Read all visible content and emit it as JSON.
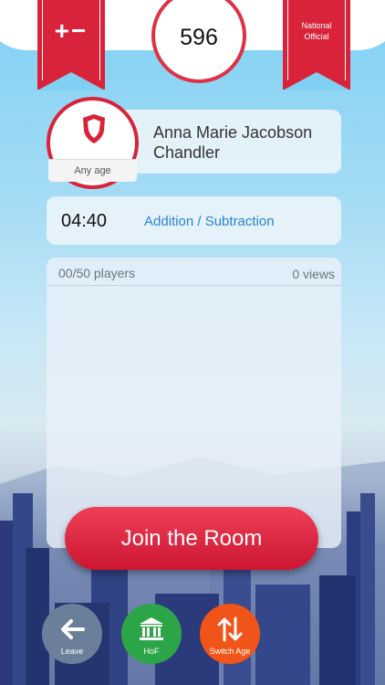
{
  "header": {
    "left_ribbon_label": "+−",
    "score": "596",
    "right_ribbon_label_1": "National",
    "right_ribbon_label_2": "Official"
  },
  "player": {
    "name": "Anna Marie Jacobson Chandler",
    "age_label": "Any age"
  },
  "game": {
    "timer": "04:40",
    "mode": "Addition / Subtraction"
  },
  "room": {
    "players": "00/50 players",
    "views": "0 views",
    "join_label": "Join the Room"
  },
  "bottom_buttons": {
    "leave": "Leave",
    "hof": "HoF",
    "switch_age": "Switch Age"
  },
  "colors": {
    "accent": "#d8233a",
    "link": "#2b82d0",
    "leave": "#6b7f9b",
    "hof": "#2ca548",
    "switch": "#f05418"
  }
}
